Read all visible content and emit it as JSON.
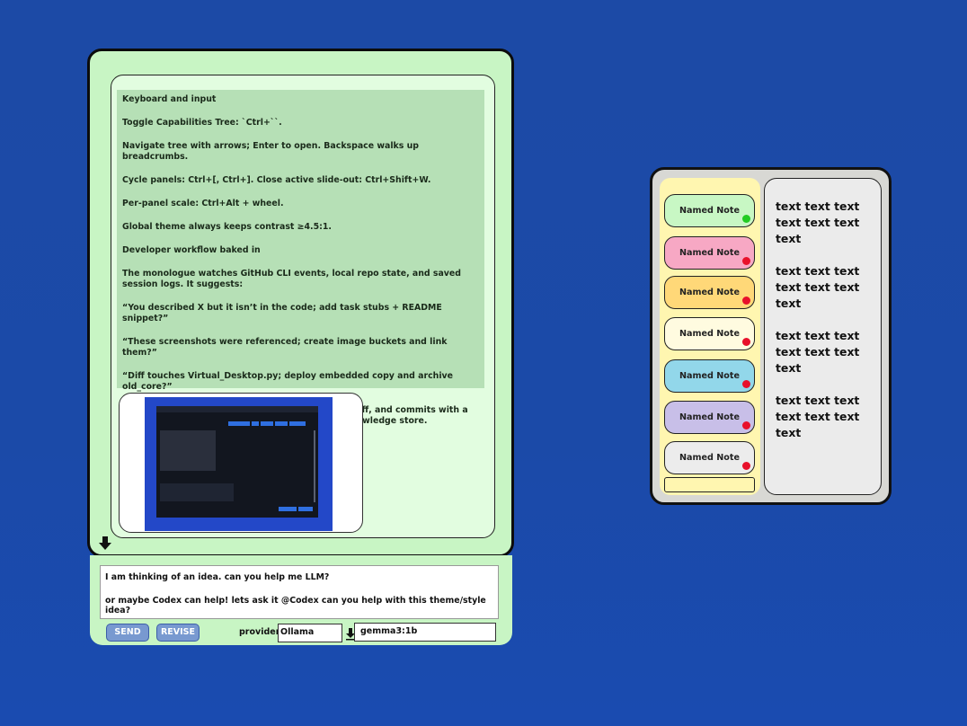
{
  "chat": {
    "messages": [
      "Keyboard and input",
      "Toggle Capabilities Tree: `Ctrl+``.",
      "Navigate tree with arrows; Enter to open. Backspace walks up breadcrumbs.",
      "Cycle panels: Ctrl+[, Ctrl+]. Close active slide-out: Ctrl+Shift+W.",
      "Per-panel scale: Ctrl+Alt + wheel.",
      "Global theme always keeps contrast ≥4.5:1.",
      "Developer workflow baked in",
      "The monologue watches GitHub CLI events, local repo state, and saved session logs. It suggests:",
      "“You described X but it isn’t in the code; add task stubs + README snippet?”",
      "“These screenshots were referenced; create image buckets and link them?”",
      "“Diff touches Virtual_Desktop.py; deploy embedded copy and archive old_core?”",
      "Clicking Apply writes the changes, opens a mini diff, and commits with a strong message. Everything is archived to the knowledge store."
    ]
  },
  "input": {
    "lines": [
      "I am thinking of an idea. can you help me LLM?",
      "or maybe Codex can help! lets ask it  @Codex can you help with this theme/style idea?"
    ],
    "send_label": "SEND",
    "revise_label": "REVISE",
    "provider_label": "provider",
    "provider_value": "Ollama",
    "model_value": "gemma3:1b"
  },
  "notes": {
    "items": [
      {
        "label": "Named Note",
        "color": "#c8f7c4",
        "dot": "#22cc22"
      },
      {
        "label": "Named Note",
        "color": "#f7a8c4",
        "dot": "#e8102a"
      },
      {
        "label": "Named Note",
        "color": "#ffd878",
        "dot": "#e8102a"
      },
      {
        "label": "Named Note",
        "color": "#fffbe0",
        "dot": "#e8102a"
      },
      {
        "label": "Named Note",
        "color": "#92d7ea",
        "dot": "#e8102a"
      },
      {
        "label": "Named Note",
        "color": "#c8bfe8",
        "dot": "#e8102a"
      },
      {
        "label": "Named Note",
        "color": "#ececec",
        "dot": "#e8102a"
      }
    ],
    "content": [
      "text text text text text text text",
      "text text text text text text text",
      "text text text text text text text",
      "text text text text text text text"
    ]
  }
}
